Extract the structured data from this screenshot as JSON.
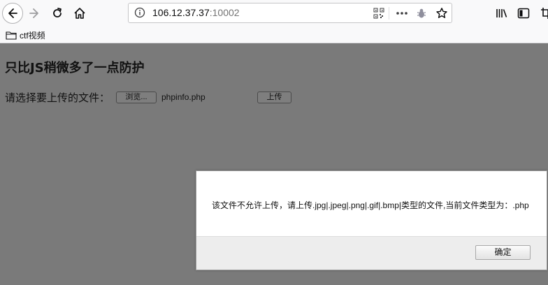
{
  "browser": {
    "url_host": "106.12.37.37",
    "url_port": ":10002",
    "bookmarks": [
      {
        "label": "ctf视频",
        "icon": "folder-icon"
      }
    ],
    "toolbar_icons": [
      "back-icon",
      "forward-icon",
      "reload-icon",
      "home-icon",
      "info-icon",
      "qr-code-icon",
      "more-icon",
      "bug-icon",
      "star-icon",
      "library-icon",
      "sidebar-icon",
      "screenshot-icon"
    ]
  },
  "page": {
    "title": "只比JS稍微多了一点防护",
    "upload_label": "请选择要上传的文件：",
    "browse_label": "浏览...",
    "file_name": "phpinfo.php",
    "upload_button": "上传"
  },
  "dialog": {
    "message": "该文件不允许上传，请上传.jpg|.jpeg|.png|.gif|.bmp|类型的文件,当前文件类型为：.php",
    "ok_label": "确定"
  },
  "colors": {
    "overlay": "#7a7a7a",
    "chrome": "#f9f9fa",
    "dialog_bg": "#ffffff",
    "dialog_footer": "#ededed"
  }
}
